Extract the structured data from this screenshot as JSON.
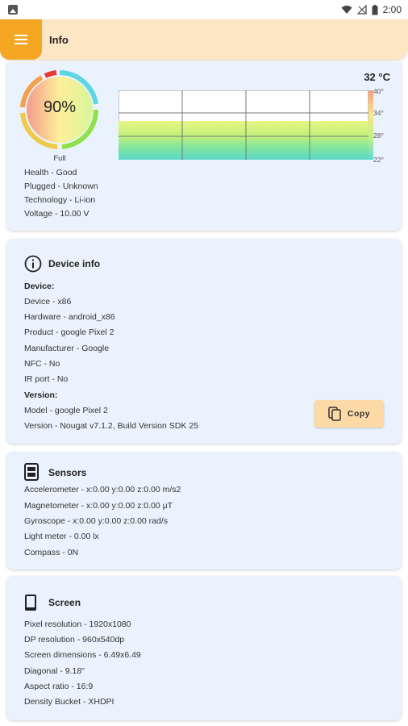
{
  "status_bar": {
    "time": "2:00",
    "icons": [
      "image-icon",
      "wifi-icon",
      "signal-icon",
      "battery-icon"
    ]
  },
  "app_bar": {
    "title": "Info",
    "menu_icon": "menu-icon",
    "accent": "#f5a623",
    "background": "#fde6c4"
  },
  "battery": {
    "level_text": "90%",
    "level": 0.9,
    "status": "Full",
    "temperature": "32 °C",
    "temp_ticks": [
      "40°",
      "34°",
      "28°",
      "22°"
    ],
    "details": [
      "Health - Good",
      "Plugged - Unknown",
      "Technology - Li-ion",
      "Voltage - 10.00 V"
    ]
  },
  "device_info": {
    "title": "Device info",
    "icon": "info-icon",
    "device_header": "Device:",
    "device_lines": [
      "Device - x86",
      "Hardware - android_x86",
      "Product - google Pixel 2",
      "Manufacturer - Google",
      "NFC - No",
      "IR port - No"
    ],
    "version_header": "Version:",
    "version_lines": [
      "Model - google Pixel 2",
      "Version - Nougat v7.1.2, Build Version SDK 25"
    ],
    "copy_label": "Copy",
    "copy_icon": "copy-icon"
  },
  "sensors": {
    "title": "Sensors",
    "icon": "sensor-icon",
    "lines": [
      "Accelerometer - x:0.00 y:0.00 z:0.00 m/s2",
      "Magnetometer - x:0.00 y:0.00 z:0.00 μT",
      "Gyroscope - x:0.00 y:0.00 z:0.00 rad/s",
      "Light meter - 0.00 lx",
      "Compass - 0N"
    ]
  },
  "screen": {
    "title": "Screen",
    "icon": "phone-icon",
    "lines": [
      "Pixel resolution - 1920x1080",
      "DP resolution - 960x540dp",
      "Screen dimensions - 6.49x6.49",
      "Diagonal - 9.18\"",
      "Aspect ratio - 16:9",
      "Density Bucket - XHDPI"
    ]
  }
}
